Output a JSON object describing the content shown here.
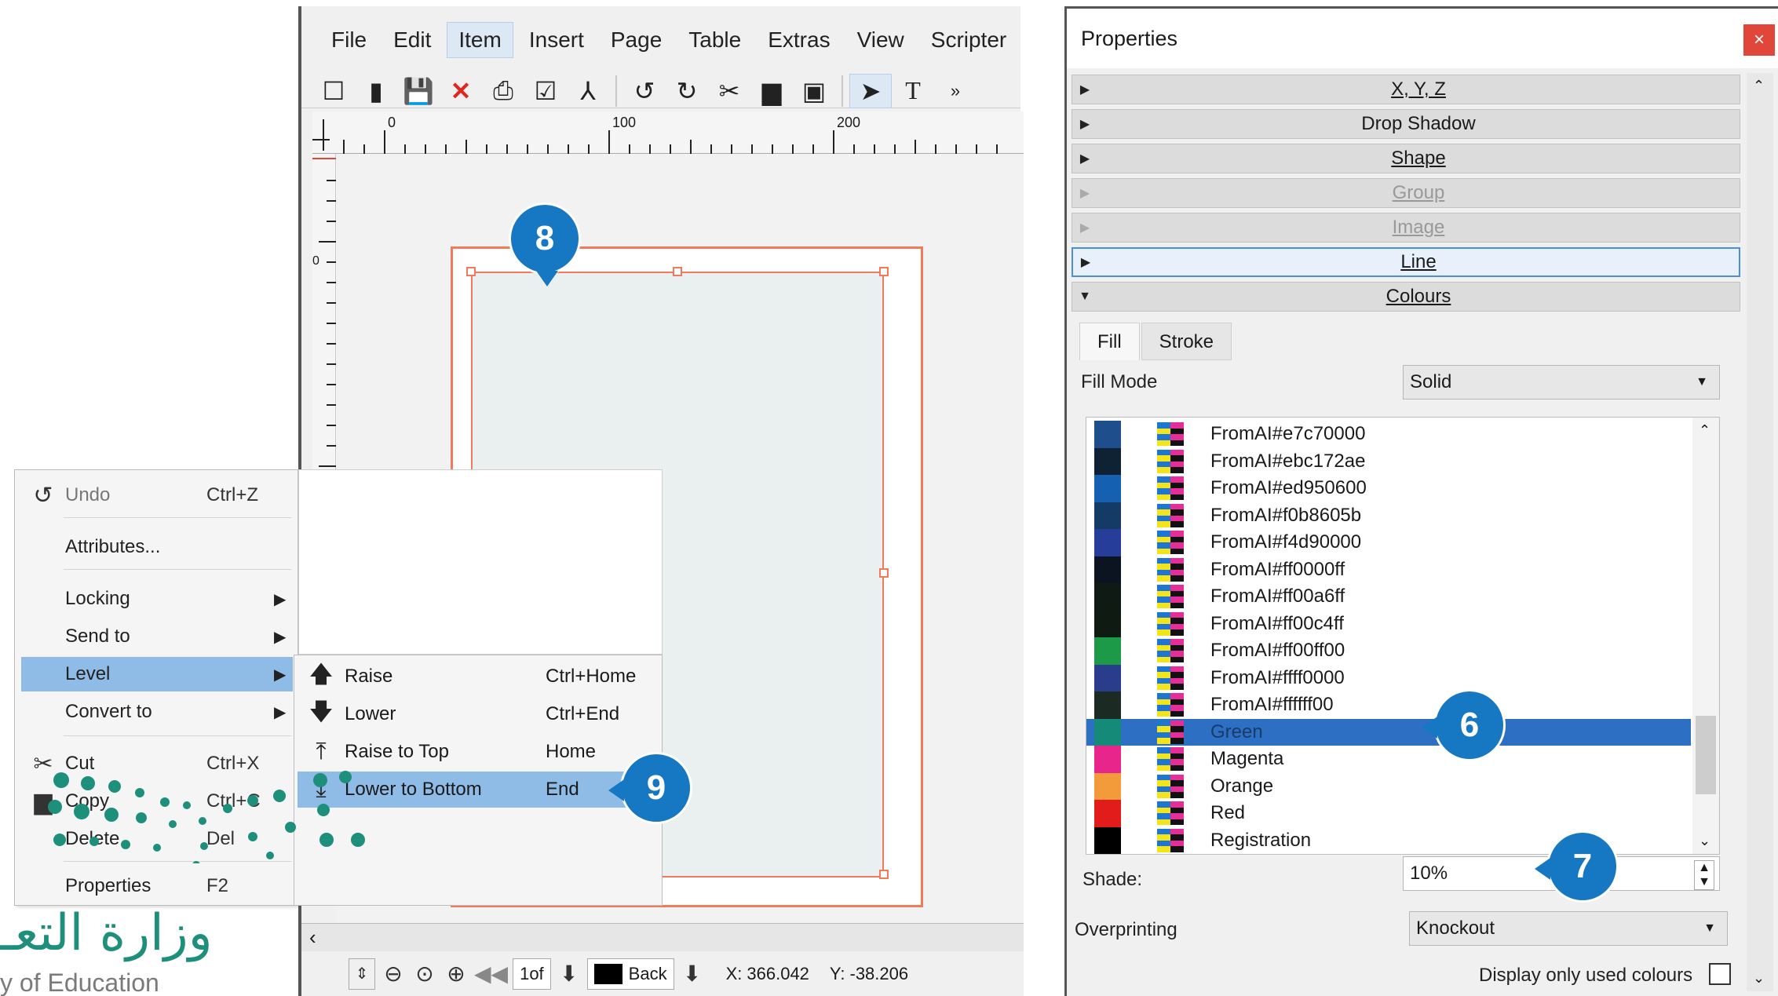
{
  "main_window": {
    "menu": [
      "File",
      "Edit",
      "Item",
      "Insert",
      "Page",
      "Table",
      "Extras",
      "View",
      "Scripter"
    ],
    "active_menu": "Item",
    "ruler_labels": [
      "0",
      "100",
      "200"
    ],
    "left_ruler_label": "0",
    "status": {
      "page_value": "1of",
      "layer": "Back",
      "x_label": "X:",
      "x_value": "366.042",
      "y_label": "Y:",
      "y_value": "-38.206"
    }
  },
  "context_menu": {
    "items": [
      {
        "label": "Undo",
        "shortcut": "Ctrl+Z",
        "icon": "undo-icon"
      },
      {
        "label": "Attributes..."
      },
      {
        "label": "Locking"
      },
      {
        "label": "Send to"
      },
      {
        "label": "Level"
      },
      {
        "label": "Convert to"
      },
      {
        "label": "Cut",
        "shortcut": "Ctrl+X",
        "icon": "scissors-icon"
      },
      {
        "label": "Copy",
        "shortcut": "Ctrl+C",
        "icon": "copy-icon"
      },
      {
        "label": "Delete",
        "shortcut": "Del"
      },
      {
        "label": "Properties",
        "shortcut": "F2"
      }
    ]
  },
  "level_submenu": {
    "items": [
      {
        "label": "Raise",
        "shortcut": "Ctrl+Home"
      },
      {
        "label": "Lower",
        "shortcut": "Ctrl+End"
      },
      {
        "label": "Raise to Top",
        "shortcut": "Home"
      },
      {
        "label": "Lower to Bottom",
        "shortcut": "End"
      }
    ]
  },
  "properties": {
    "title": "Properties",
    "close": "×",
    "sections": [
      "X, Y, Z",
      "Drop Shadow",
      "Shape",
      "Group",
      "Image",
      "Line",
      "Colours"
    ],
    "tabs": [
      "Fill",
      "Stroke"
    ],
    "fill_mode_label": "Fill Mode",
    "fill_mode_value": "Solid",
    "colors": [
      {
        "name": "FromAI#e7c70000",
        "swatch": "#1f4e8c"
      },
      {
        "name": "FromAI#ebc172ae",
        "swatch": "#0f2233"
      },
      {
        "name": "FromAI#ed950600",
        "swatch": "#1560b0"
      },
      {
        "name": "FromAI#f0b8605b",
        "swatch": "#143a66"
      },
      {
        "name": "FromAI#f4d90000",
        "swatch": "#263d9a"
      },
      {
        "name": "FromAI#ff0000ff",
        "swatch": "#0b1420"
      },
      {
        "name": "FromAI#ff00a6ff",
        "swatch": "#101a14"
      },
      {
        "name": "FromAI#ff00c4ff",
        "swatch": "#0e1a12"
      },
      {
        "name": "FromAI#ff00ff00",
        "swatch": "#1d9a48"
      },
      {
        "name": "FromAI#ffff0000",
        "swatch": "#2a3c8c"
      },
      {
        "name": "FromAI#ffffff00",
        "swatch": "#1c2a24"
      },
      {
        "name": "Green",
        "swatch": "#168a78"
      },
      {
        "name": "Magenta",
        "swatch": "#e7258a"
      },
      {
        "name": "Orange",
        "swatch": "#f39a3a"
      },
      {
        "name": "Red",
        "swatch": "#e21b1b"
      },
      {
        "name": "Registration",
        "swatch": "#000000"
      }
    ],
    "selected_color": "Green",
    "shade_label": "Shade:",
    "shade_value": "10%",
    "overprinting_label": "Overprinting",
    "overprinting_value": "Knockout",
    "display_used_label": "Display only used colours"
  },
  "callouts": [
    "8",
    "9",
    "6",
    "7"
  ],
  "logo": {
    "arabic": "وزارة التعـ",
    "english": "y of Education"
  }
}
